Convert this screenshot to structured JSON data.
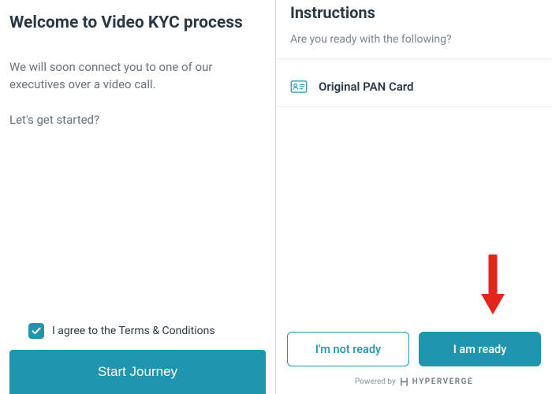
{
  "left": {
    "title": "Welcome to Video KYC process",
    "body1": "We will soon connect you to one of our executives over a video call.",
    "body2": "Let's get started?",
    "consent_label": "I agree to the Terms & Conditions",
    "consent_checked": true,
    "start_label": "Start Journey"
  },
  "right": {
    "instructions_title": "Instructions",
    "instructions_sub": "Are you ready with the following?",
    "item_label": "Original PAN Card",
    "not_ready_label": "I'm not ready",
    "ready_label": "I am ready",
    "powered_by_label": "Powered by",
    "brand": "HYPERVERGE"
  },
  "colors": {
    "accent": "#1f95b0",
    "arrow": "#e3261b"
  }
}
